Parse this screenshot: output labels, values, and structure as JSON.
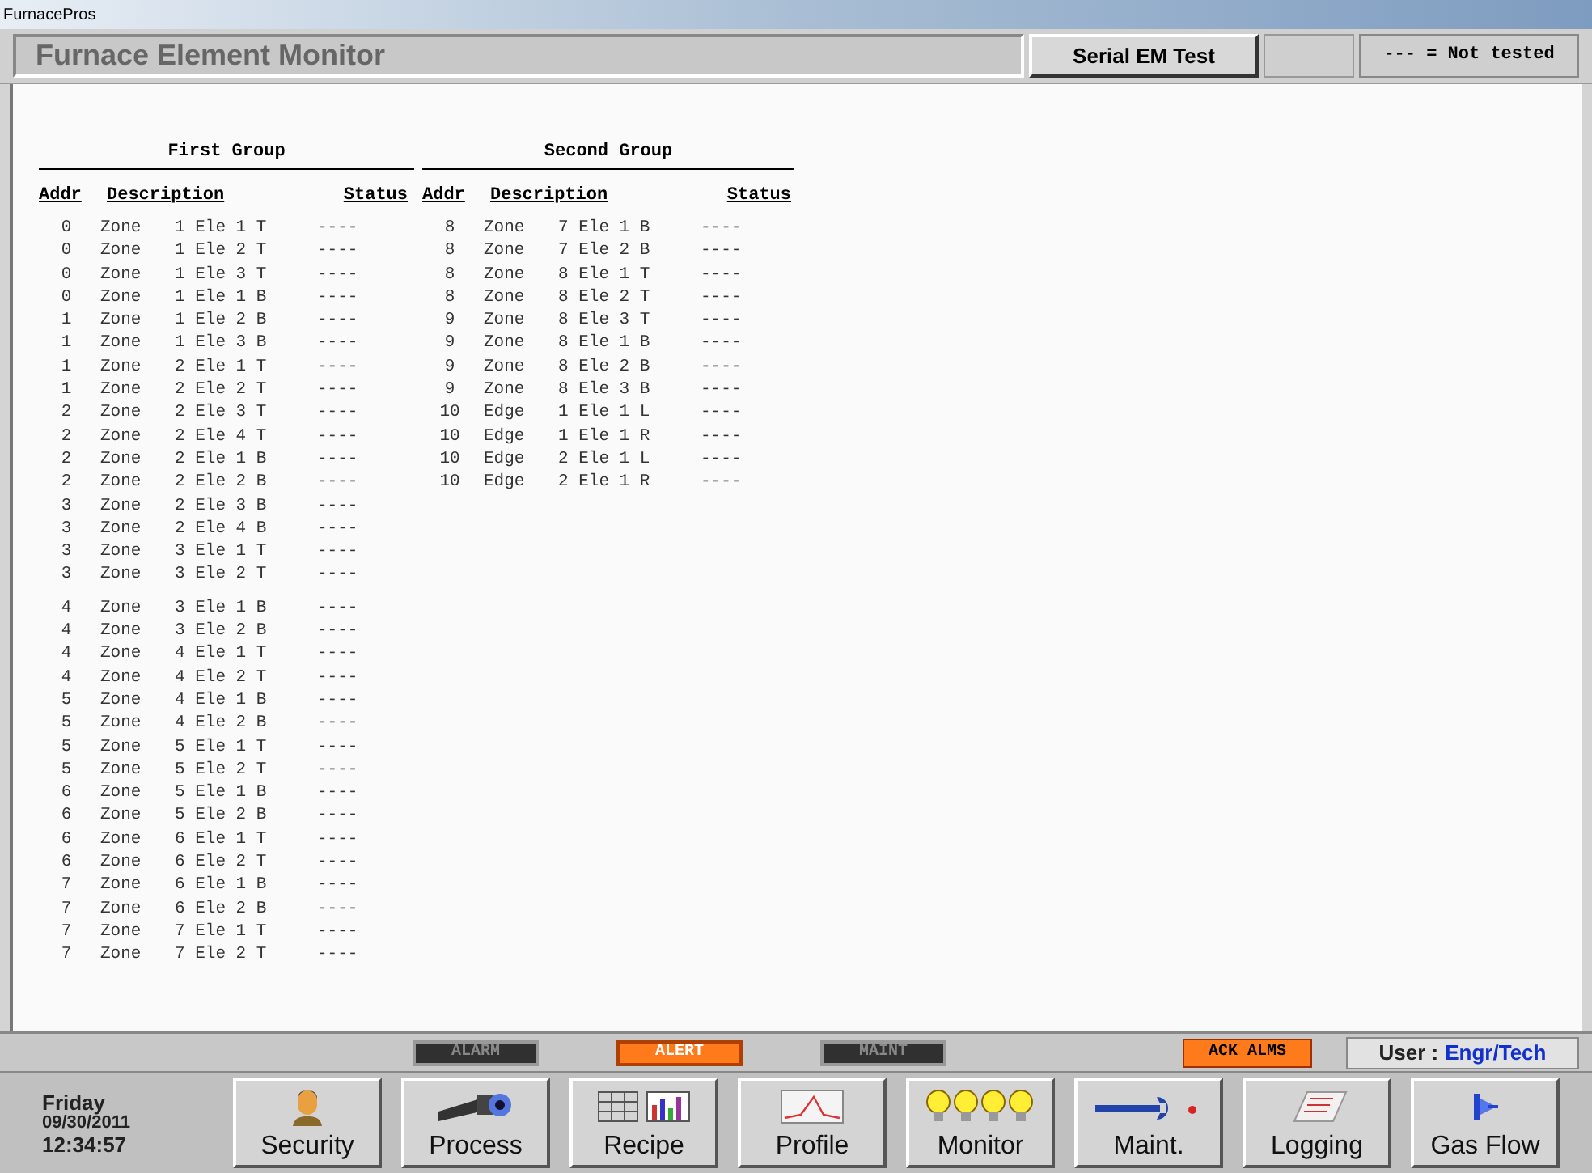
{
  "window": {
    "title": "FurnacePros"
  },
  "header": {
    "title": "Furnace Element Monitor",
    "button": "Serial EM Test",
    "legend": "--- = Not tested"
  },
  "groups": [
    {
      "title": "First Group",
      "columns": [
        "Addr",
        "Description",
        "Status"
      ],
      "rows": [
        [
          "0",
          "Zone",
          "1 Ele 1 T",
          "----"
        ],
        [
          "0",
          "Zone",
          "1 Ele 2 T",
          "----"
        ],
        [
          "0",
          "Zone",
          "1 Ele 3 T",
          "----"
        ],
        [
          "0",
          "Zone",
          "1 Ele 1 B",
          "----"
        ],
        [
          "1",
          "Zone",
          "1 Ele 2 B",
          "----"
        ],
        [
          "1",
          "Zone",
          "1 Ele 3 B",
          "----"
        ],
        [
          "1",
          "Zone",
          "2 Ele 1 T",
          "----"
        ],
        [
          "1",
          "Zone",
          "2 Ele 2 T",
          "----"
        ],
        [
          "2",
          "Zone",
          "2 Ele 3 T",
          "----"
        ],
        [
          "2",
          "Zone",
          "2 Ele 4 T",
          "----"
        ],
        [
          "2",
          "Zone",
          "2 Ele 1 B",
          "----"
        ],
        [
          "2",
          "Zone",
          "2 Ele 2 B",
          "----"
        ],
        [
          "3",
          "Zone",
          "2 Ele 3 B",
          "----"
        ],
        [
          "3",
          "Zone",
          "2 Ele 4 B",
          "----"
        ],
        [
          "3",
          "Zone",
          "3 Ele 1 T",
          "----"
        ],
        [
          "3",
          "Zone",
          "3 Ele 2 T",
          "----"
        ],
        [
          "4",
          "Zone",
          "3 Ele 1 B",
          "----"
        ],
        [
          "4",
          "Zone",
          "3 Ele 2 B",
          "----"
        ],
        [
          "4",
          "Zone",
          "4 Ele 1 T",
          "----"
        ],
        [
          "4",
          "Zone",
          "4 Ele 2 T",
          "----"
        ],
        [
          "5",
          "Zone",
          "4 Ele 1 B",
          "----"
        ],
        [
          "5",
          "Zone",
          "4 Ele 2 B",
          "----"
        ],
        [
          "5",
          "Zone",
          "5 Ele 1 T",
          "----"
        ],
        [
          "5",
          "Zone",
          "5 Ele 2 T",
          "----"
        ],
        [
          "6",
          "Zone",
          "5 Ele 1 B",
          "----"
        ],
        [
          "6",
          "Zone",
          "5 Ele 2 B",
          "----"
        ],
        [
          "6",
          "Zone",
          "6 Ele 1 T",
          "----"
        ],
        [
          "6",
          "Zone",
          "6 Ele 2 T",
          "----"
        ],
        [
          "7",
          "Zone",
          "6 Ele 1 B",
          "----"
        ],
        [
          "7",
          "Zone",
          "6 Ele 2 B",
          "----"
        ],
        [
          "7",
          "Zone",
          "7 Ele 1 T",
          "----"
        ],
        [
          "7",
          "Zone",
          "7 Ele 2 T",
          "----"
        ]
      ]
    },
    {
      "title": "Second Group",
      "columns": [
        "Addr",
        "Description",
        "Status"
      ],
      "rows": [
        [
          "8",
          "Zone",
          "7 Ele 1 B",
          "----"
        ],
        [
          "8",
          "Zone",
          "7 Ele 2 B",
          "----"
        ],
        [
          "8",
          "Zone",
          "8 Ele 1 T",
          "----"
        ],
        [
          "8",
          "Zone",
          "8 Ele 2 T",
          "----"
        ],
        [
          "9",
          "Zone",
          "8 Ele 3 T",
          "----"
        ],
        [
          "9",
          "Zone",
          "8 Ele 1 B",
          "----"
        ],
        [
          "9",
          "Zone",
          "8 Ele 2 B",
          "----"
        ],
        [
          "9",
          "Zone",
          "8 Ele 3 B",
          "----"
        ],
        [
          "10",
          "Edge",
          "1 Ele 1 L",
          "----"
        ],
        [
          "10",
          "Edge",
          "1 Ele 1 R",
          "----"
        ],
        [
          "10",
          "Edge",
          "2 Ele 1 L",
          "----"
        ],
        [
          "10",
          "Edge",
          "2 Ele 1 R",
          "----"
        ]
      ]
    }
  ],
  "indicators": [
    {
      "label": "ALARM",
      "on": false
    },
    {
      "label": "ALERT",
      "on": true
    },
    {
      "label": "MAINT",
      "on": false
    }
  ],
  "ack_button": "ACK ALMS",
  "user": {
    "label": "User :",
    "name": "Engr/Tech"
  },
  "clock": {
    "day": "Friday",
    "date": "09/30/2011",
    "time": "12:34:57"
  },
  "nav": [
    {
      "label": "Security",
      "kind": "person"
    },
    {
      "label": "Process",
      "kind": "binoculars"
    },
    {
      "label": "Recipe",
      "kind": "recipe"
    },
    {
      "label": "Profile",
      "kind": "profile"
    },
    {
      "label": "Monitor",
      "kind": "bulbs"
    },
    {
      "label": "Maint.",
      "kind": "wrench"
    },
    {
      "label": "Logging",
      "kind": "log"
    },
    {
      "label": "Gas Flow",
      "kind": "valve"
    }
  ]
}
